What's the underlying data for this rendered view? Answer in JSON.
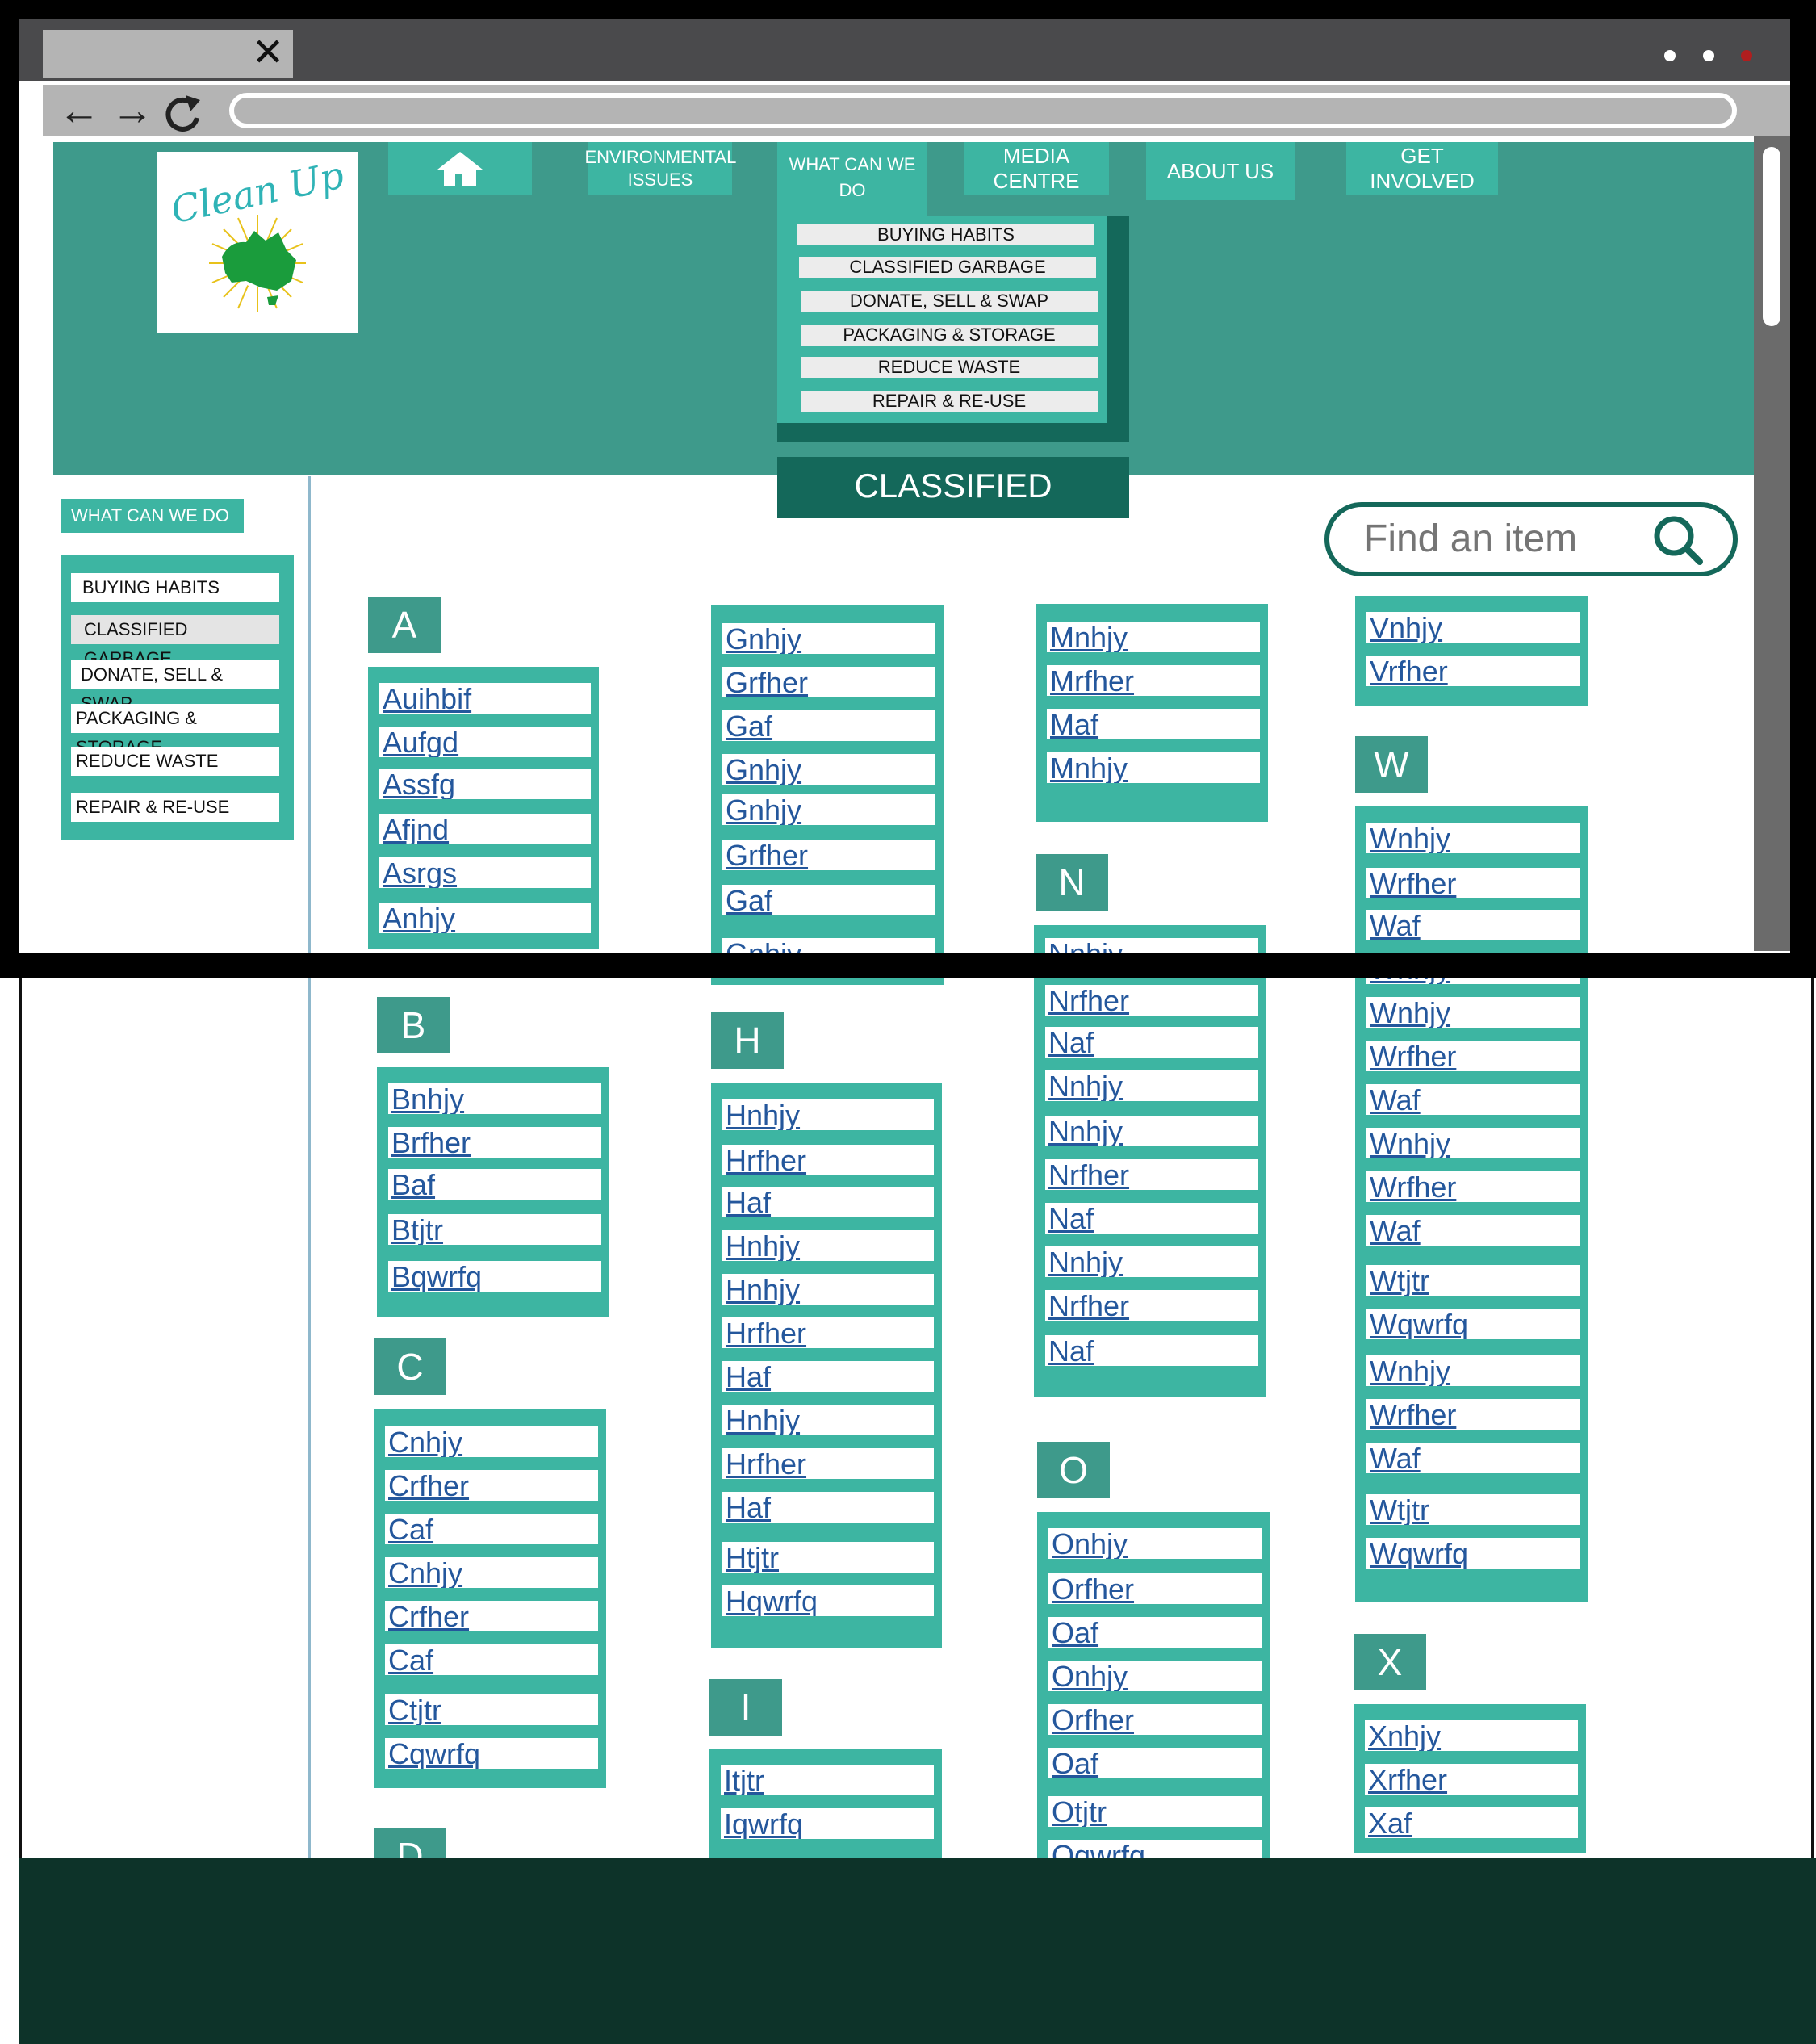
{
  "browser": {
    "tab_close_glyph": "✕",
    "back_glyph": "←",
    "forward_glyph": "→",
    "url": "",
    "window_dots": [
      "#ffffff",
      "#ffffff",
      "#b01e1e"
    ]
  },
  "logo": {
    "text": "Clean Up"
  },
  "nav": {
    "home_icon": "home-icon",
    "environmental": "ENVIRONMENTAL ISSUES",
    "what_can_we_do": "WHAT CAN WE DO",
    "media_centre": "MEDIA CENTRE",
    "about_us": "ABOUT US",
    "get_involved": "GET INVOLVED"
  },
  "dropdown": [
    "BUYING HABITS",
    "CLASSIFIED GARBAGE",
    "DONATE, SELL & SWAP",
    "PACKAGING & STORAGE",
    "REDUCE WASTE",
    "REPAIR & RE-USE"
  ],
  "page_title": "CLASSIFIED GARBAGE",
  "search": {
    "placeholder": "Find an item"
  },
  "sidebar": {
    "heading": "WHAT CAN WE DO",
    "items": [
      "BUYING HABITS",
      "CLASSIFIED GARBAGE",
      "DONATE, SELL & SWAP",
      "PACKAGING & STORAGE",
      "REDUCE WASTE",
      "REPAIR & RE-USE"
    ]
  },
  "sections": {
    "A": {
      "letter": "A",
      "items": [
        "Auihbif",
        "Aufgd",
        "Assfg",
        "Afjnd",
        "Asrgs",
        "Anhjy"
      ]
    },
    "B": {
      "letter": "B",
      "items": [
        "Bnhjy",
        "Brfher",
        "Baf",
        "Btjtr",
        "Bqwrfq"
      ]
    },
    "C": {
      "letter": "C",
      "items": [
        "Cnhjy",
        "Crfher",
        "Caf",
        "Cnhjy",
        "Crfher",
        "Caf",
        "Ctjtr",
        "Cqwrfq"
      ]
    },
    "D": {
      "letter": "D"
    },
    "G": {
      "items": [
        "Gnhjy",
        "Grfher",
        "Gaf",
        "Gnhjy",
        "Gnhjy",
        "Grfher",
        "Gaf",
        "Gnhjy"
      ]
    },
    "H": {
      "letter": "H",
      "items": [
        "Hnhjy",
        "Hrfher",
        "Haf",
        "Hnhjy",
        "Hnhjy",
        "Hrfher",
        "Haf",
        "Hnhjy",
        "Hrfher",
        "Haf",
        "Htjtr",
        "Hqwrfq"
      ]
    },
    "I": {
      "letter": "I",
      "items": [
        "Itjtr",
        "Iqwrfq"
      ]
    },
    "M": {
      "items": [
        "Mnhjy",
        "Mrfher",
        "Maf",
        "Mnhjy"
      ]
    },
    "N": {
      "letter": "N",
      "items": [
        "Nnhjy",
        "Nrfher",
        "Naf",
        "Nnhjy",
        "Nnhjy",
        "Nrfher",
        "Naf",
        "Nnhjy",
        "Nrfher",
        "Naf"
      ]
    },
    "O": {
      "letter": "O",
      "items": [
        "Onhjy",
        "Orfher",
        "Oaf",
        "Onhjy",
        "Orfher",
        "Oaf",
        "Otjtr",
        "Oqwrfq"
      ]
    },
    "V": {
      "items": [
        "Vnhjy",
        "Vrfher"
      ]
    },
    "W": {
      "letter": "W",
      "items": [
        "Wnhjy",
        "Wrfher",
        "Waf",
        "Wnhjy",
        "Wnhjy",
        "Wrfher",
        "Waf",
        "Wnhjy",
        "Wrfher",
        "Waf",
        "Wtjtr",
        "Wqwrfq",
        "Wnhjy",
        "Wrfher",
        "Waf",
        "Wtjtr",
        "Wqwrfq"
      ]
    },
    "X": {
      "letter": "X",
      "items": [
        "Xnhjy",
        "Xrfher",
        "Xaf"
      ]
    }
  },
  "colors": {
    "teal_header": "#3e9a8b",
    "teal_box": "#3db5a2",
    "dark_teal": "#14685a",
    "link": "#24579c",
    "footer": "#0d3329"
  }
}
